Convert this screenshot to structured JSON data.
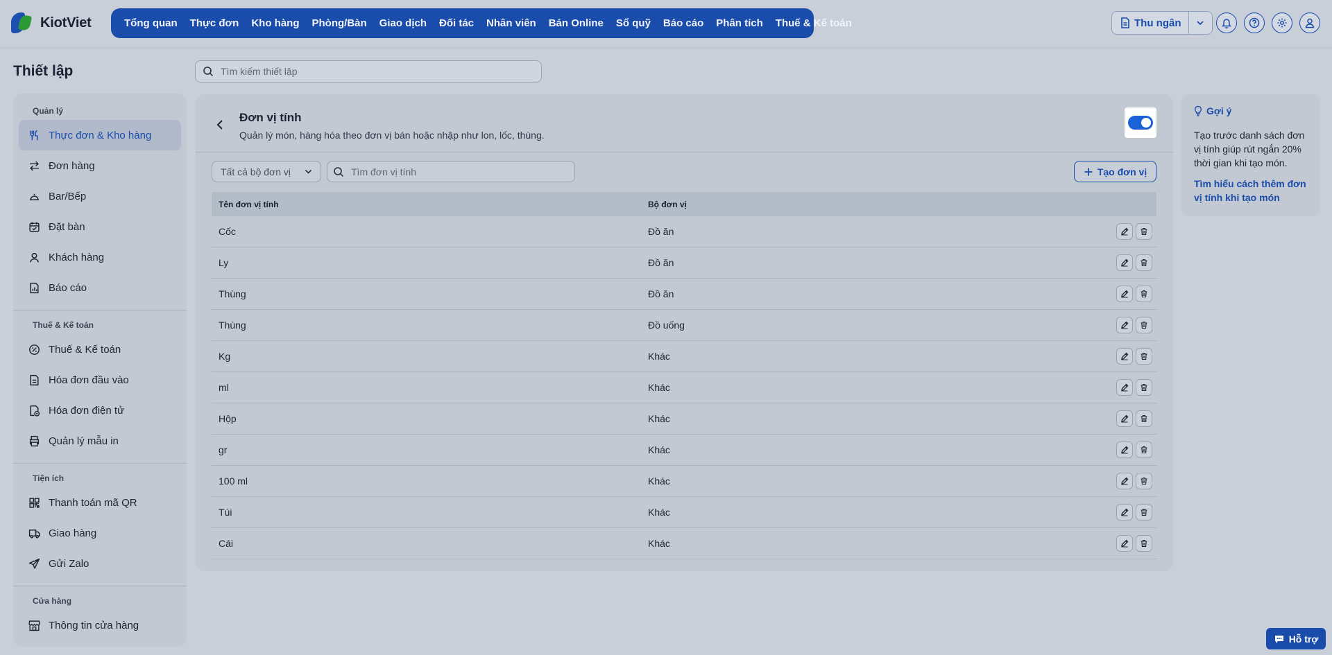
{
  "brand": {
    "name": "KiotViet"
  },
  "topnav": [
    {
      "label": "Tổng quan",
      "name": "nav-overview"
    },
    {
      "label": "Thực đơn",
      "name": "nav-menu"
    },
    {
      "label": "Kho hàng",
      "name": "nav-warehouse"
    },
    {
      "label": "Phòng/Bàn",
      "name": "nav-rooms-tables"
    },
    {
      "label": "Giao dịch",
      "name": "nav-transactions"
    },
    {
      "label": "Đối tác",
      "name": "nav-partners"
    },
    {
      "label": "Nhân viên",
      "name": "nav-staff"
    },
    {
      "label": "Bán Online",
      "name": "nav-online-sales"
    },
    {
      "label": "Sổ quỹ",
      "name": "nav-cashbook"
    },
    {
      "label": "Báo cáo",
      "name": "nav-reports"
    },
    {
      "label": "Phân tích",
      "name": "nav-analytics"
    },
    {
      "label": "Thuế & Kế toán",
      "name": "nav-tax-accounting"
    }
  ],
  "header": {
    "cashier_label": "Thu ngân"
  },
  "page": {
    "title": "Thiết lập",
    "search_placeholder": "Tìm kiếm thiết lập"
  },
  "sidebar": {
    "groups": [
      {
        "title": "Quản lý",
        "items": [
          {
            "label": "Thực đơn & Kho hàng",
            "icon": "utensils-icon",
            "active": true
          },
          {
            "label": "Đơn hàng",
            "icon": "swap-arrows-icon"
          },
          {
            "label": "Bar/Bếp",
            "icon": "cloche-icon"
          },
          {
            "label": "Đặt bàn",
            "icon": "calendar-check-icon"
          },
          {
            "label": "Khách hàng",
            "icon": "user-icon"
          },
          {
            "label": "Báo cáo",
            "icon": "report-icon"
          }
        ]
      },
      {
        "title": "Thuế & Kế toán",
        "items": [
          {
            "label": "Thuế & Kế toán",
            "icon": "percent-badge-icon"
          },
          {
            "label": "Hóa đơn đầu vào",
            "icon": "document-icon"
          },
          {
            "label": "Hóa đơn điện tử",
            "icon": "e-invoice-icon"
          },
          {
            "label": "Quản lý mẫu in",
            "icon": "printer-icon"
          }
        ]
      },
      {
        "title": "Tiện ích",
        "items": [
          {
            "label": "Thanh toán mã QR",
            "icon": "qr-code-icon"
          },
          {
            "label": "Giao hàng",
            "icon": "truck-icon"
          },
          {
            "label": "Gửi Zalo",
            "icon": "send-icon"
          }
        ]
      },
      {
        "title": "Cửa hàng",
        "items": [
          {
            "label": "Thông tin cửa hàng",
            "icon": "store-icon"
          }
        ]
      }
    ]
  },
  "panel": {
    "title": "Đơn vị tính",
    "description": "Quản lý món, hàng hóa theo đơn vị bán hoặc nhập như lon, lốc, thùng.",
    "enabled": true,
    "filter_label": "Tất cả bộ đơn vị",
    "search_placeholder": "Tìm đơn vị tính",
    "create_label": "Tạo đơn vị",
    "columns": {
      "name": "Tên đơn vị tính",
      "group": "Bộ đơn vị"
    },
    "rows": [
      {
        "name": "Cốc",
        "group": "Đồ ăn"
      },
      {
        "name": "Ly",
        "group": "Đồ ăn"
      },
      {
        "name": "Thùng",
        "group": "Đồ ăn"
      },
      {
        "name": "Thùng",
        "group": "Đồ uống"
      },
      {
        "name": "Kg",
        "group": "Khác"
      },
      {
        "name": "ml",
        "group": "Khác"
      },
      {
        "name": "Hộp",
        "group": "Khác"
      },
      {
        "name": "gr",
        "group": "Khác"
      },
      {
        "name": "100 ml",
        "group": "Khác"
      },
      {
        "name": "Túi",
        "group": "Khác"
      },
      {
        "name": "Cái",
        "group": "Khác"
      }
    ]
  },
  "hint": {
    "title": "Gợi ý",
    "text": "Tạo trước danh sách đơn vị tính giúp rút ngắn 20% thời gian khi tạo món.",
    "link": "Tìm hiểu cách thêm đơn vị tính khi tạo món"
  },
  "support": {
    "label": "Hỗ trợ"
  },
  "colors": {
    "brand_blue": "#1a4cab",
    "toggle_on": "#1a62d8",
    "logo_green": "#2d9a3a"
  }
}
